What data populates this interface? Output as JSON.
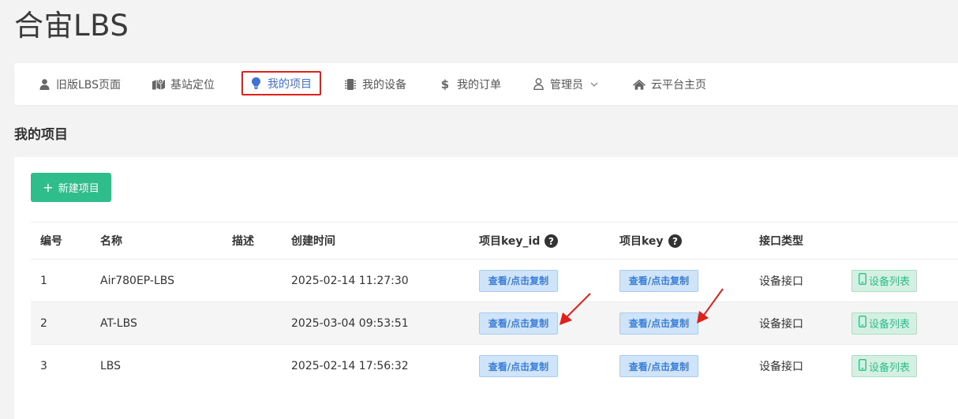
{
  "app_title": "合宙LBS",
  "nav": {
    "items": [
      {
        "label": "旧版LBS页面",
        "icon": "user-icon"
      },
      {
        "label": "基站定位",
        "icon": "map-icon"
      },
      {
        "label": "我的项目",
        "icon": "lightbulb-icon"
      },
      {
        "label": "我的设备",
        "icon": "chip-icon"
      },
      {
        "label": "我的订单",
        "icon": "dollar-icon"
      },
      {
        "label": "管理员",
        "icon": "user-outline-icon"
      },
      {
        "label": "云平台主页",
        "icon": "home-icon"
      }
    ],
    "active_index": 2
  },
  "section_title": "我的项目",
  "new_button_label": "新建项目",
  "table": {
    "headers": [
      "编号",
      "名称",
      "描述",
      "创建时间",
      "项目key_id",
      "项目key",
      "接口类型"
    ],
    "rows": [
      {
        "id": "1",
        "name": "Air780EP-LBS",
        "desc": "",
        "created": "2025-02-14 11:27:30",
        "key_id_btn": "查看/点击复制",
        "key_btn": "查看/点击复制",
        "api_type": "设备接口",
        "device_btn": "设备列表"
      },
      {
        "id": "2",
        "name": "AT-LBS",
        "desc": "",
        "created": "2025-03-04 09:53:51",
        "key_id_btn": "查看/点击复制",
        "key_btn": "查看/点击复制",
        "api_type": "设备接口",
        "device_btn": "设备列表"
      },
      {
        "id": "3",
        "name": "LBS",
        "desc": "",
        "created": "2025-02-14 17:56:32",
        "key_id_btn": "查看/点击复制",
        "key_btn": "查看/点击复制",
        "api_type": "设备接口",
        "device_btn": "设备列表"
      }
    ]
  },
  "colors": {
    "accent_green": "#2fbd8b",
    "active_blue": "#3f6fd8",
    "highlight_red": "#e0201b",
    "key_button_bg": "#cfe4f9"
  }
}
